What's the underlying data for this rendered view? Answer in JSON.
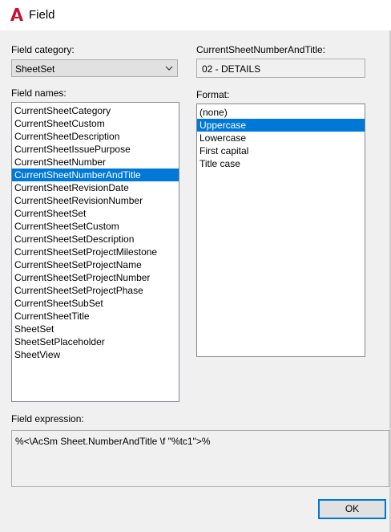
{
  "window": {
    "title": "Field"
  },
  "category": {
    "label": "Field category:",
    "value": "SheetSet"
  },
  "field_names": {
    "label": "Field names:",
    "items": [
      "CurrentSheetCategory",
      "CurrentSheetCustom",
      "CurrentSheetDescription",
      "CurrentSheetIssuePurpose",
      "CurrentSheetNumber",
      "CurrentSheetNumberAndTitle",
      "CurrentSheetRevisionDate",
      "CurrentSheetRevisionNumber",
      "CurrentSheetSet",
      "CurrentSheetSetCustom",
      "CurrentSheetSetDescription",
      "CurrentSheetSetProjectMilestone",
      "CurrentSheetSetProjectName",
      "CurrentSheetSetProjectNumber",
      "CurrentSheetSetProjectPhase",
      "CurrentSheetSubSet",
      "CurrentSheetTitle",
      "SheetSet",
      "SheetSetPlaceholder",
      "SheetView"
    ],
    "selected": "CurrentSheetNumberAndTitle"
  },
  "value_preview": {
    "label": "CurrentSheetNumberAndTitle:",
    "value": "02 - DETAILS"
  },
  "format": {
    "label": "Format:",
    "items": [
      "(none)",
      "Uppercase",
      "Lowercase",
      "First capital",
      "Title case"
    ],
    "selected": "Uppercase"
  },
  "expression": {
    "label": "Field expression:",
    "value": "%<\\AcSm Sheet.NumberAndTitle \\f \"%tc1\">%"
  },
  "buttons": {
    "ok": "OK"
  },
  "colors": {
    "selection": "#0078d7",
    "app_icon": "#c8102e"
  },
  "icons": {
    "app": "autocad-a-icon",
    "dropdown": "chevron-down-icon"
  }
}
